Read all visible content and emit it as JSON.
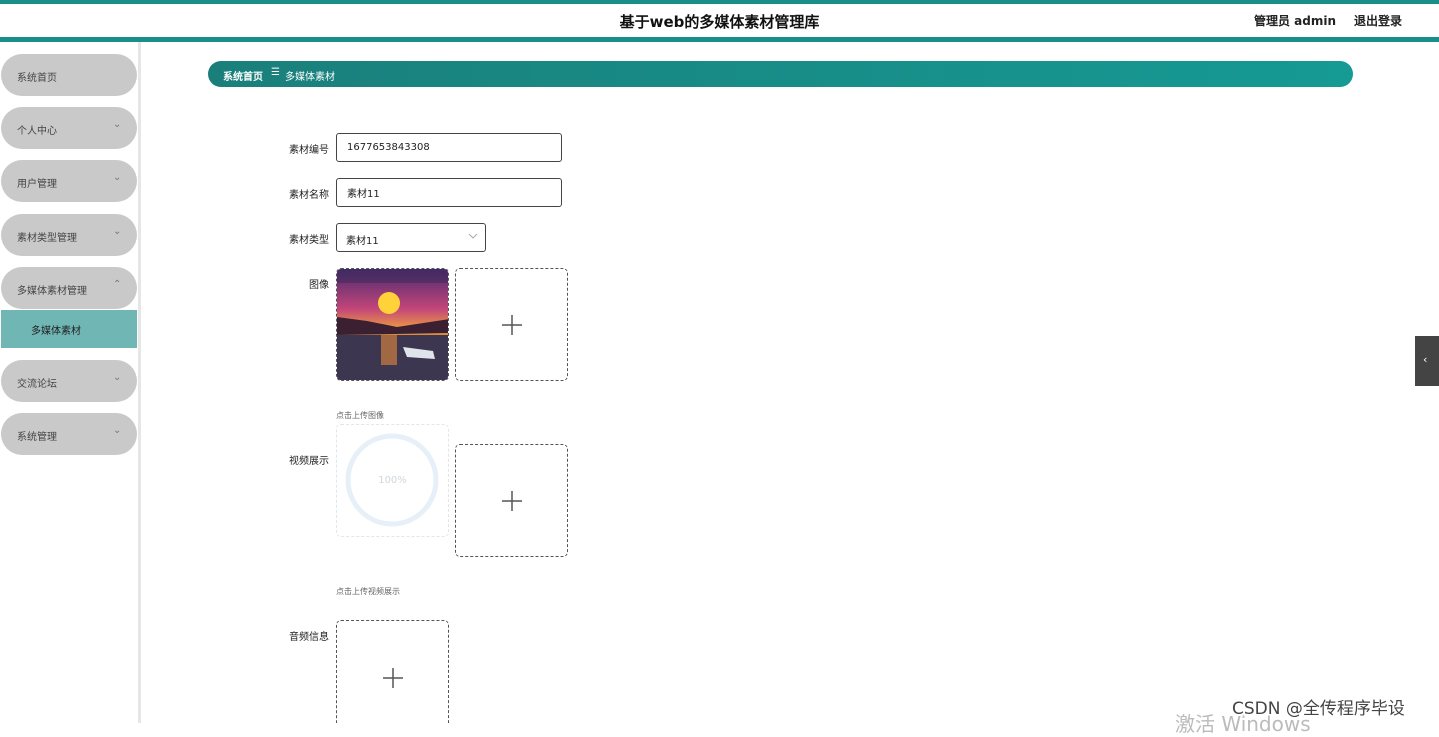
{
  "header": {
    "title": "基于web的多媒体素材管理库",
    "admin_label": "管理员 admin",
    "logout_label": "退出登录"
  },
  "sidebar": {
    "items": [
      {
        "label": "系统首页",
        "has_chevron": false
      },
      {
        "label": "个人中心",
        "has_chevron": true,
        "chevron": "⌄"
      },
      {
        "label": "用户管理",
        "has_chevron": true,
        "chevron": "⌄"
      },
      {
        "label": "素材类型管理",
        "has_chevron": true,
        "chevron": "⌄"
      },
      {
        "label": "多媒体素材管理",
        "has_chevron": true,
        "chevron": "⌃",
        "expanded": true
      },
      {
        "label": "交流论坛",
        "has_chevron": true,
        "chevron": "⌄"
      },
      {
        "label": "系统管理",
        "has_chevron": true,
        "chevron": "⌄"
      }
    ],
    "sub_items": [
      {
        "label": "多媒体素材",
        "active": true
      }
    ]
  },
  "breadcrumb": {
    "home": "系统首页",
    "separator": "☰",
    "current": "多媒体素材"
  },
  "form": {
    "code_label": "素材编号",
    "code_value": "1677653843308",
    "name_label": "素材名称",
    "name_value": "素材11",
    "type_label": "素材类型",
    "type_value": "素材11",
    "image_label": "图像",
    "image_hint": "点击上传图像",
    "video_label": "视频展示",
    "video_progress": "100%",
    "video_hint": "点击上传视频展示",
    "audio_label": "音频信息"
  },
  "icons": {
    "plus": "plus-icon",
    "chevron_down": "chevron-down-icon",
    "collapse": "chevron-left-icon"
  },
  "side_tab": {
    "glyph": "‹"
  },
  "watermark": "CSDN @全传程序毕设",
  "os_overlay": "激活 Windows",
  "colors": {
    "accent": "#1a8f8a",
    "menu_bg": "#c9c9c9",
    "submenu_active": "#6fb6b4"
  }
}
